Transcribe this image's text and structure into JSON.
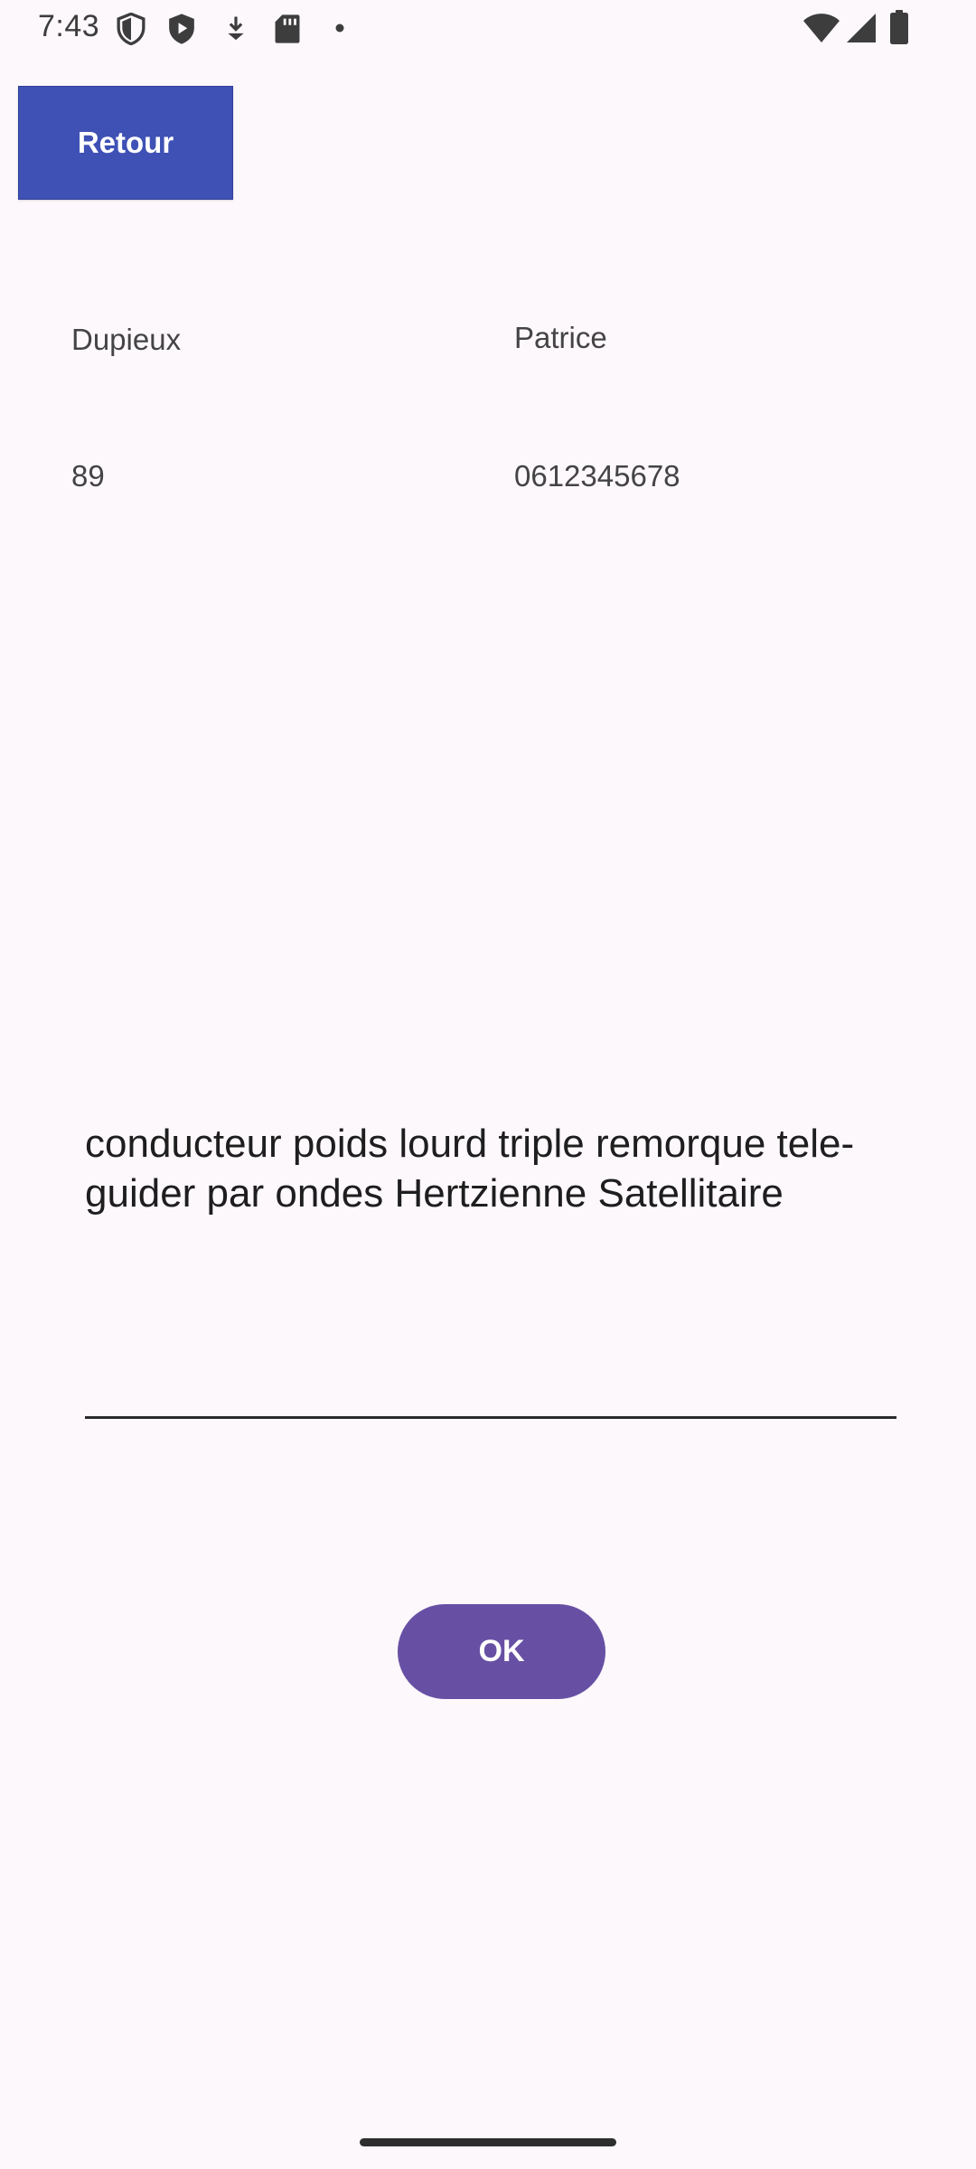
{
  "status_bar": {
    "time": "7:43",
    "icons_left": [
      "shield-outline-icon",
      "play-shield-icon",
      "download-icon",
      "sd-card-icon",
      "dot-icon"
    ],
    "icons_right": [
      "wifi-icon",
      "cellular-signal-icon",
      "battery-icon"
    ],
    "icon_color": "#3d3d3d"
  },
  "toolbar": {
    "back_label": "Retour",
    "back_color": "#3f51b5"
  },
  "profile": {
    "last_name": "Dupieux",
    "first_name": "Patrice",
    "number": "89",
    "phone": "0612345678"
  },
  "description": {
    "value": "conducteur poids lourd triple remorque tele-guider par ondes Hertzienne Satellitaire"
  },
  "actions": {
    "ok_label": "OK",
    "ok_color": "#6750a4"
  },
  "colors": {
    "background": "#fdf8fc"
  }
}
